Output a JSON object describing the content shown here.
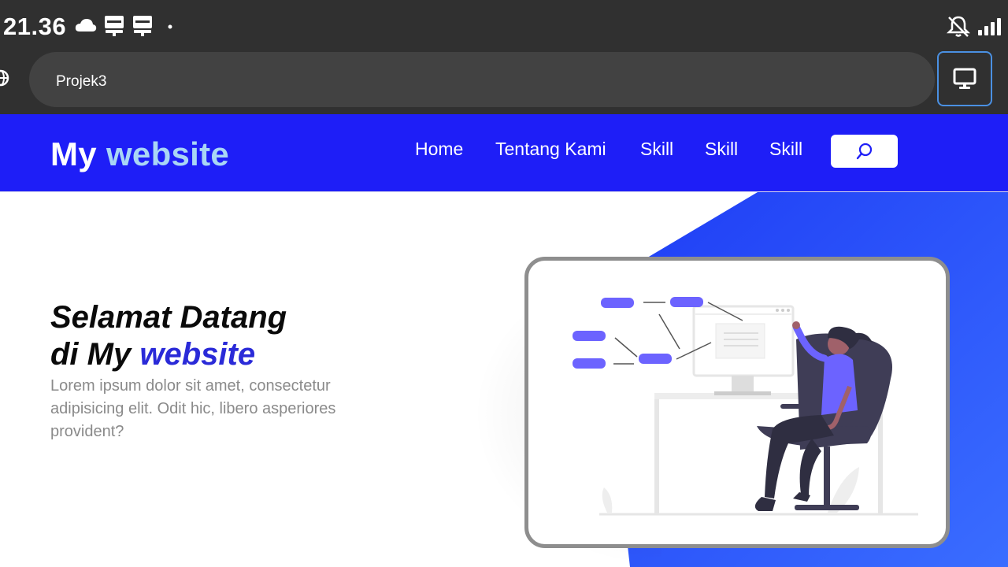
{
  "status_bar": {
    "time": "21.36",
    "left_icons": [
      "cloud-icon",
      "notification-icon",
      "notification-icon",
      "dot-icon"
    ],
    "right_icons": [
      "mute-icon",
      "signal-icon"
    ]
  },
  "browser": {
    "url_text": "Projek3",
    "site_icon": "globe-icon",
    "desktop_icon": "monitor-icon"
  },
  "site": {
    "brand": {
      "prefix": "My",
      "accent": "website"
    },
    "nav": [
      {
        "label": "Home"
      },
      {
        "label": "Tentang Kami"
      },
      {
        "label": "Skill"
      },
      {
        "label": "Skill"
      },
      {
        "label": "Skill"
      }
    ],
    "search_icon": "search-icon"
  },
  "hero": {
    "title_line1": "Selamat Datang",
    "title_line2_prefix": "di My",
    "title_line2_accent": "website",
    "description": "Lorem ipsum dolor sit amet, consectetur adipisicing elit. Odit hic, libero asperiores provident?"
  },
  "colors": {
    "navbar": "#1e1ef7",
    "brand_accent": "#a9d6f5",
    "title_accent": "#2a2ad8",
    "hero_gradient": [
      "#1e3cf5",
      "#3a6dff"
    ],
    "illustration_accent": "#6c63ff",
    "browser_chrome": "#303030"
  }
}
